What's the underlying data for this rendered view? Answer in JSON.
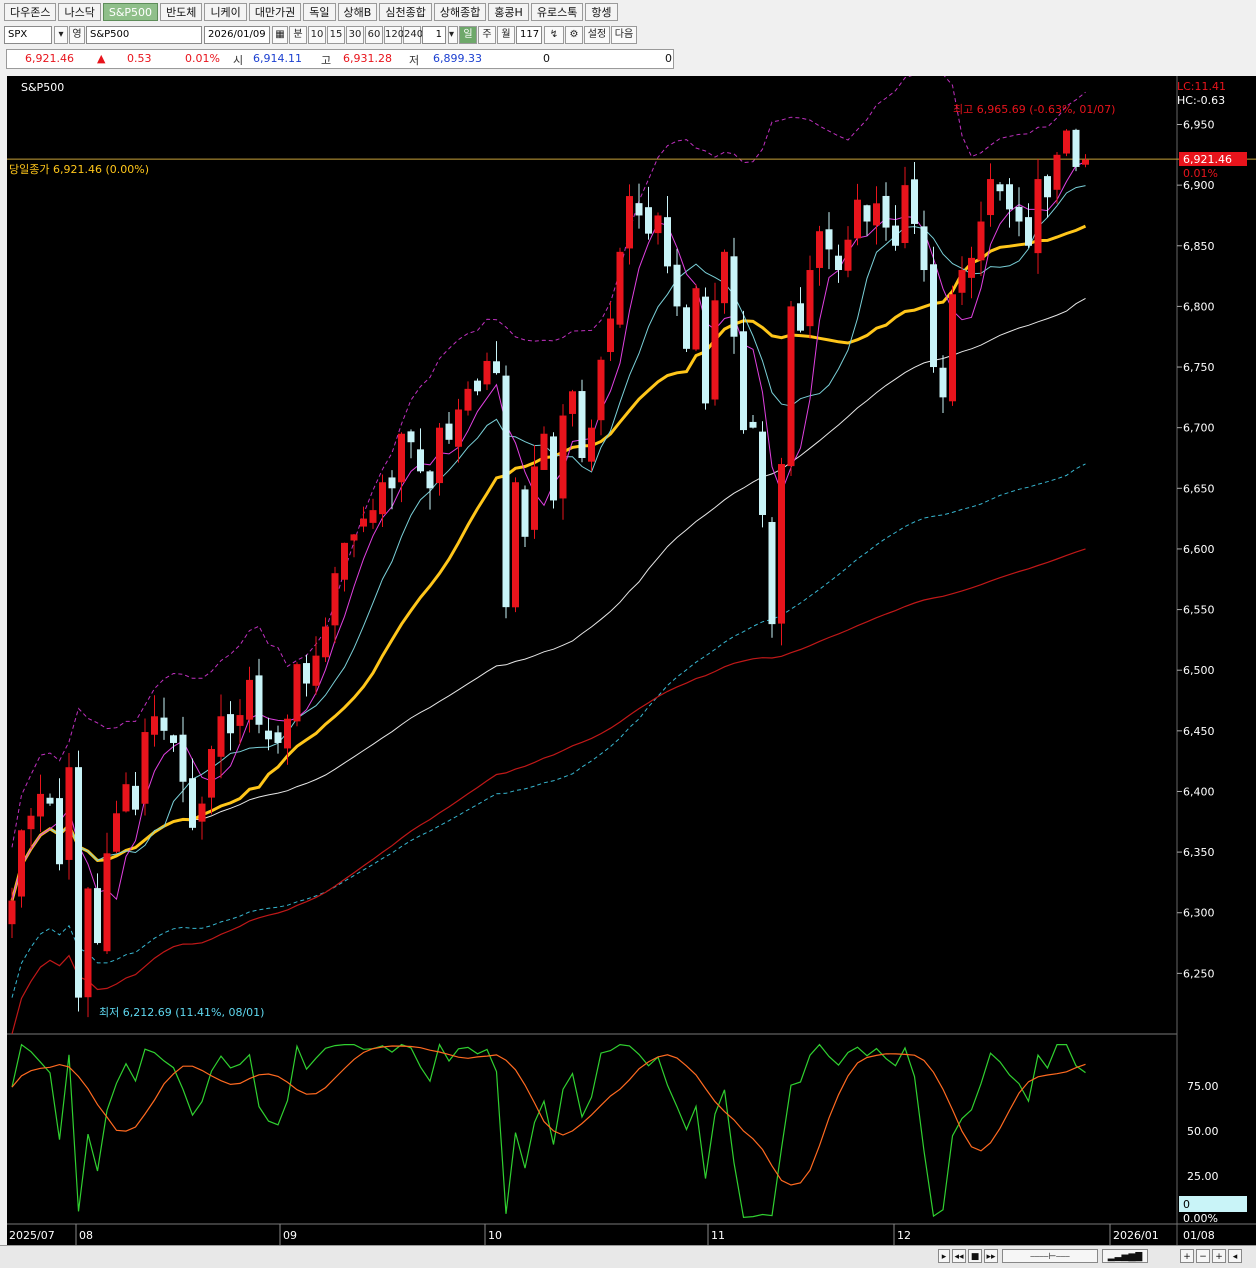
{
  "tabs": [
    "다우존스",
    "나스닥",
    "S&P500",
    "반도체",
    "니케이",
    "대만가권",
    "독일",
    "상해B",
    "심천종합",
    "상해종합",
    "홍콩H",
    "유로스톡",
    "항셍"
  ],
  "active_tab": 2,
  "toolbar": {
    "code": "SPX",
    "lang_icon": "영",
    "name": "S&P500",
    "date": "2026/01/09",
    "unit_label": "분",
    "intervals": [
      "10",
      "15",
      "30",
      "60",
      "120",
      "240"
    ],
    "count": "1",
    "period_day": "일",
    "period_week": "주",
    "period_month": "월",
    "bars": "117",
    "settings_label": "설정",
    "next_label": "다음"
  },
  "price": {
    "last": "6,921.46",
    "arrow": "▲",
    "change": "0.53",
    "pct": "0.01%",
    "open_label": "시",
    "open": "6,914.11",
    "high_label": "고",
    "high": "6,931.28",
    "low_label": "저",
    "low": "6,899.33",
    "vol1": "0",
    "vol2": "0"
  },
  "chart_labels": {
    "series_name": "S&P500",
    "close_line": "당일종가 6,921.46 (0.00%)",
    "high_note": "최고 6,965.69 (-0.63%, 01/07)",
    "low_note": "최저 6,212.69 (11.41%, 08/01)",
    "lc": "LC:11.41",
    "hc": "HC:-0.63",
    "current_tag": "6,921.46",
    "current_pct": "0.01%",
    "osc_box_value": "0",
    "osc_box_pct": "0.00%"
  },
  "x_axis_labels": [
    "2025/07",
    "08",
    "09",
    "10",
    "11",
    "12",
    "2026/01"
  ],
  "x_axis_right": "01/08",
  "colors": {
    "up": "#e8141c",
    "down": "#c9f4f8",
    "ma_yellow": "#ffc61a",
    "close_line": "#c8a23a"
  },
  "chart_data": {
    "type": "candlestick",
    "title": "S&P500",
    "ylim": [
      6200,
      6990
    ],
    "y_ticks": [
      6250,
      6300,
      6350,
      6400,
      6450,
      6500,
      6550,
      6600,
      6650,
      6700,
      6750,
      6800,
      6850,
      6900,
      6950
    ],
    "osc_ticks": [
      25,
      50,
      75
    ],
    "close": [
      6310,
      6368,
      6380,
      6398,
      6390,
      6340,
      6420,
      6230,
      6320,
      6275,
      6349,
      6382,
      6406,
      6385,
      6449,
      6462,
      6450,
      6440,
      6408,
      6370,
      6390,
      6435,
      6462,
      6448,
      6463,
      6492,
      6455,
      6443,
      6440,
      6460,
      6505,
      6489,
      6512,
      6536,
      6580,
      6605,
      6612,
      6625,
      6632,
      6655,
      6650,
      6695,
      6688,
      6664,
      6650,
      6700,
      6690,
      6715,
      6732,
      6730,
      6755,
      6745,
      6552,
      6655,
      6610,
      6668,
      6695,
      6640,
      6710,
      6730,
      6675,
      6700,
      6756,
      6790,
      6845,
      6891,
      6875,
      6860,
      6875,
      6833,
      6800,
      6765,
      6815,
      6720,
      6805,
      6845,
      6775,
      6698,
      6700,
      6628,
      6538,
      6670,
      6800,
      6780,
      6830,
      6862,
      6847,
      6830,
      6855,
      6888,
      6870,
      6885,
      6865,
      6850,
      6900,
      6868,
      6830,
      6750,
      6725,
      6810,
      6830,
      6840,
      6870,
      6905,
      6895,
      6880,
      6870,
      6850,
      6905,
      6890,
      6925,
      6945,
      6915,
      6921
    ]
  }
}
